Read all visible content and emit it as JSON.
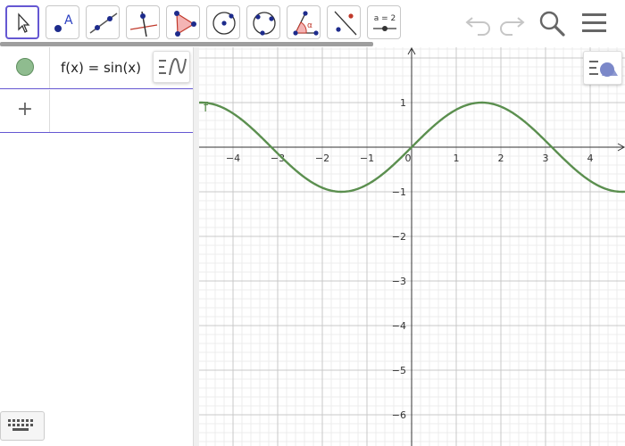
{
  "toolbar": {
    "tools": [
      {
        "name": "move-tool",
        "icon": "arrow-cursor-icon",
        "active": true
      },
      {
        "name": "point-tool",
        "icon": "point-icon",
        "letter": "A"
      },
      {
        "name": "line-tool",
        "icon": "line-through-points-icon"
      },
      {
        "name": "perpendicular-tool",
        "icon": "perpendicular-line-icon"
      },
      {
        "name": "polygon-tool",
        "icon": "polygon-icon"
      },
      {
        "name": "circle-center-tool",
        "icon": "circle-center-point-icon"
      },
      {
        "name": "circle-three-points-tool",
        "icon": "circle-three-points-icon"
      },
      {
        "name": "angle-tool",
        "icon": "angle-icon",
        "letter": "α"
      },
      {
        "name": "reflect-tool",
        "icon": "reflect-about-line-icon"
      },
      {
        "name": "slider-tool",
        "icon": "slider-icon",
        "label": "a = 2"
      }
    ],
    "undo_icon": "undo-icon",
    "redo_icon": "redo-icon",
    "search_icon": "search-icon",
    "menu_icon": "hamburger-menu-icon"
  },
  "algebra": {
    "rows": [
      {
        "expression": "f(x) = sin(x)",
        "color": "#8fbc8f"
      }
    ],
    "input_placeholder": "+",
    "style_button_icon": "algebra-style-icon",
    "keyboard_icon": "keyboard-icon"
  },
  "graphics": {
    "style_button_icon": "graphics-style-icon",
    "function_label": "f",
    "x_ticks": [
      "−4",
      "−3",
      "−2",
      "−1",
      "0",
      "1",
      "2",
      "3",
      "4"
    ],
    "y_ticks": [
      "1",
      "−1",
      "−2",
      "−3",
      "−4",
      "−5",
      "−6"
    ],
    "curve_color": "#5b8f4f",
    "xlim": [
      -4.76,
      4.78
    ],
    "ylim": [
      -6.7,
      2.24
    ]
  },
  "chart_data": {
    "type": "line",
    "title": "",
    "xlabel": "",
    "ylabel": "",
    "xlim": [
      -4.76,
      4.78
    ],
    "ylim": [
      -6.7,
      2.24
    ],
    "grid": true,
    "series": [
      {
        "name": "f",
        "function": "sin(x)",
        "color": "#5b8f4f"
      }
    ]
  }
}
